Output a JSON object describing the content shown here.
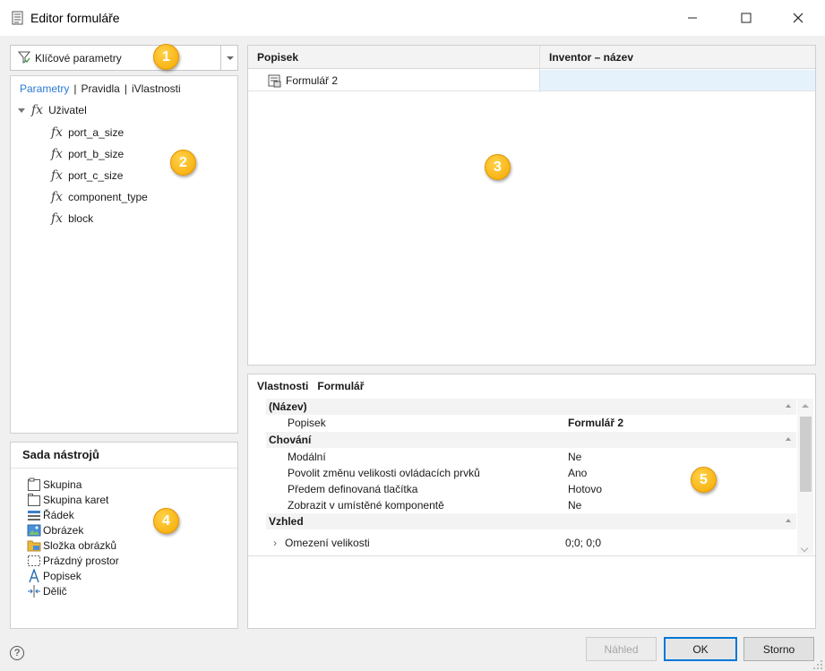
{
  "window": {
    "title": "Editor formuláře",
    "controls": [
      "minimize-icon",
      "maximize-icon",
      "close-icon"
    ]
  },
  "filter": {
    "label": "Klíčové parametry"
  },
  "param_tabs": {
    "parameters": "Parametry",
    "sep1": "|",
    "rules": "Pravidla",
    "sep2": "|",
    "iprops": "iVlastnosti"
  },
  "tree": {
    "group": "Uživatel",
    "items": [
      "port_a_size",
      "port_b_size",
      "port_c_size",
      "component_type",
      "block"
    ],
    "fx_symbol": "fx"
  },
  "toolbox": {
    "title": "Sada nástrojů",
    "items": [
      {
        "label": "Skupina",
        "icon": "group-icon"
      },
      {
        "label": "Skupina karet",
        "icon": "tab-group-icon"
      },
      {
        "label": "Řádek",
        "icon": "row-icon"
      },
      {
        "label": "Obrázek",
        "icon": "picture-icon"
      },
      {
        "label": "Složka obrázků",
        "icon": "picture-folder-icon"
      },
      {
        "label": "Prázdný prostor",
        "icon": "empty-space-icon"
      },
      {
        "label": "Popisek",
        "icon": "label-icon"
      },
      {
        "label": "Dělič",
        "icon": "splitter-icon"
      }
    ]
  },
  "grid": {
    "columns": [
      "Popisek",
      "Inventor – název"
    ],
    "rows": [
      {
        "label": "Formulář 2",
        "inventor_name": ""
      }
    ]
  },
  "properties": {
    "header_left": "Vlastnosti",
    "header_right": "Formulář",
    "categories": [
      {
        "name": "(Název)",
        "rows": [
          {
            "name": "Popisek",
            "value": "Formulář 2"
          }
        ]
      },
      {
        "name": "Chování",
        "rows": [
          {
            "name": "Modální",
            "value": "Ne"
          },
          {
            "name": "Povolit změnu velikosti ovládacích prvků",
            "value": "Ano"
          },
          {
            "name": "Předem definovaná tlačítka",
            "value": "Hotovo"
          },
          {
            "name": "Zobrazit v umístěné komponentě",
            "value": "Ne"
          }
        ]
      },
      {
        "name": "Vzhled",
        "rows": [
          {
            "name": "Omezení velikosti",
            "value": "0;0; 0;0"
          }
        ]
      }
    ]
  },
  "buttons": {
    "preview": "Náhled",
    "ok": "OK",
    "cancel": "Storno"
  },
  "help": "?",
  "badges": [
    "1",
    "2",
    "3",
    "4",
    "5"
  ],
  "colors": {
    "accent": "#2b7bd4",
    "badge": "#f6a800",
    "selection": "#e5f1fb"
  }
}
